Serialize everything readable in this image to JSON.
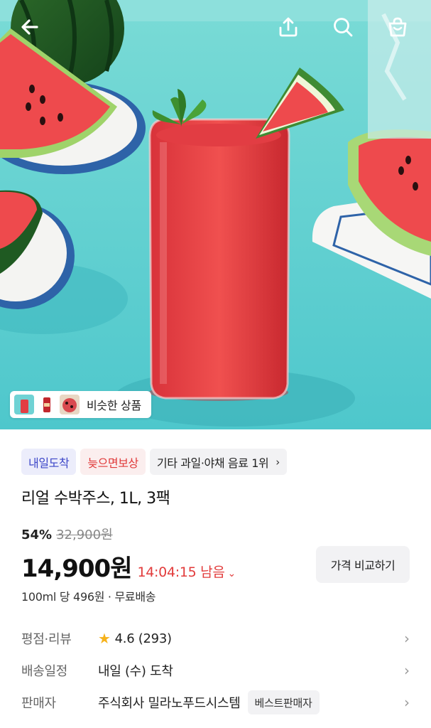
{
  "header": {
    "back_icon": "arrow-left-icon",
    "share_icon": "share-icon",
    "search_icon": "search-icon",
    "cart_icon": "cart-icon"
  },
  "similar": {
    "label": "비슷한 상품"
  },
  "badges": [
    {
      "label": "내일도착",
      "color": "#3c46c8"
    },
    {
      "label": "늦으면보상",
      "color": "#e03a3a"
    },
    {
      "label": "기타 과일·야채 음료 1위",
      "color": "#222222"
    }
  ],
  "product": {
    "title": "리얼 수박주스, 1L, 3팩",
    "discount": "54%",
    "original_price": "32,900원",
    "price": "14,900원",
    "timer": "14:04:15 남음",
    "compare_label": "가격 비교하기",
    "unit_info": "100ml 당 496원 · 무료배송"
  },
  "details": {
    "rating": {
      "key": "평점·리뷰",
      "value": "4.6 (293)"
    },
    "delivery": {
      "key": "배송일정",
      "value": "내일 (수) 도착"
    },
    "seller": {
      "key": "판매자",
      "value": "주식회사 밀라노푸드시스템",
      "badge": "베스트판매자"
    }
  }
}
